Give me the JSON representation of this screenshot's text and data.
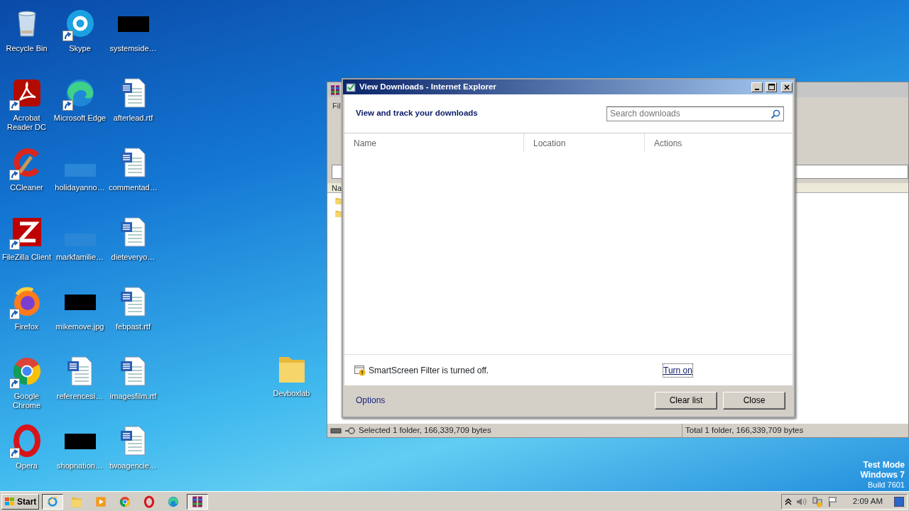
{
  "desktop": {
    "icons": [
      {
        "label": "Recycle Bin",
        "kind": "recycle-bin",
        "shortcut": false
      },
      {
        "label": "Acrobat Reader DC",
        "kind": "acrobat",
        "shortcut": true
      },
      {
        "label": "CCleaner",
        "kind": "ccleaner",
        "shortcut": true
      },
      {
        "label": "FileZilla Client",
        "kind": "filezilla",
        "shortcut": true
      },
      {
        "label": "Firefox",
        "kind": "firefox",
        "shortcut": true
      },
      {
        "label": "Google Chrome",
        "kind": "chrome",
        "shortcut": true
      },
      {
        "label": "Opera",
        "kind": "opera",
        "shortcut": true
      },
      {
        "label": "Skype",
        "kind": "skype",
        "shortcut": true
      },
      {
        "label": "Microsoft Edge",
        "kind": "edge",
        "shortcut": true
      },
      {
        "label": "holidayanno…",
        "kind": "blank",
        "shortcut": false
      },
      {
        "label": "markfamilie…",
        "kind": "blank",
        "shortcut": false
      },
      {
        "label": "mikemove.jpg",
        "kind": "redacted",
        "shortcut": false
      },
      {
        "label": "referencesi…",
        "kind": "word",
        "shortcut": false
      },
      {
        "label": "shopnation…",
        "kind": "redacted",
        "shortcut": false
      },
      {
        "label": "systemside…",
        "kind": "redacted",
        "shortcut": false
      },
      {
        "label": "afterlead.rtf",
        "kind": "word",
        "shortcut": false
      },
      {
        "label": "commentad…",
        "kind": "word",
        "shortcut": false
      },
      {
        "label": "dieteveryo…",
        "kind": "word",
        "shortcut": false
      },
      {
        "label": "febpast.rtf",
        "kind": "word",
        "shortcut": false
      },
      {
        "label": "imagesfilm.rtf",
        "kind": "word",
        "shortcut": false
      },
      {
        "label": "twoagencie…",
        "kind": "word",
        "shortcut": false
      }
    ],
    "loose_icons": [
      {
        "label": "Devboxlab",
        "kind": "folder",
        "shortcut": false
      }
    ]
  },
  "background_window": {
    "menu": [
      "Fil"
    ],
    "column_header": "Na",
    "status_bar": [
      "Selected 1 folder, 166,339,709 bytes",
      "Total 1 folder, 166,339,709 bytes"
    ]
  },
  "dialog": {
    "title": "View Downloads - Internet Explorer",
    "heading": "View and track your downloads",
    "search": {
      "placeholder": "Search downloads"
    },
    "columns": [
      "Name",
      "Location",
      "Actions"
    ],
    "notice": {
      "text": "SmartScreen Filter is turned off.",
      "link": "Turn on"
    },
    "options_link": "Options",
    "buttons": [
      "Clear list",
      "Close"
    ]
  },
  "taskbar": {
    "start": "Start",
    "apps": [
      {
        "kind": "ie",
        "selected": true
      },
      {
        "kind": "explorer",
        "selected": false
      },
      {
        "kind": "media",
        "selected": false
      },
      {
        "kind": "chrome",
        "selected": false
      },
      {
        "kind": "opera",
        "selected": false
      },
      {
        "kind": "edge",
        "selected": false
      },
      {
        "kind": "winrar",
        "selected": true
      }
    ],
    "clock": "2:09 AM"
  },
  "test_mode": [
    "Test Mode",
    "Windows 7",
    "Build 7601"
  ]
}
